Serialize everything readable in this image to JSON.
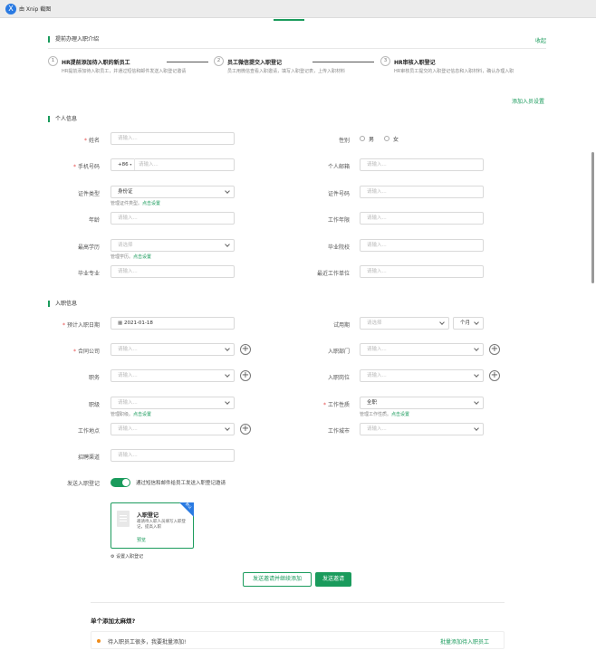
{
  "app": {
    "title": "由 Xnip 截图",
    "logo": "X"
  },
  "intro": {
    "title": "提前办理入职介绍",
    "collapse": "收起",
    "steps": [
      {
        "num": "1",
        "title": "HR提前添加待入职的新员工",
        "desc": "HR提前添加待入职员工，并通过短信和邮件发送入职登记邀请"
      },
      {
        "num": "2",
        "title": "员工微信提交入职登记",
        "desc": "员工用微信查看入职邀请，填写入职登记表，上传入职材料"
      },
      {
        "num": "3",
        "title": "HR审核入职登记",
        "desc": "HR审核员工提交的入职登记信息和入职材料，确认办理入职"
      }
    ]
  },
  "settings_link": "添加入员设置",
  "personal": {
    "title": "个人信息",
    "name": {
      "label": "姓名",
      "placeholder": "请输入..."
    },
    "gender": {
      "label": "性别",
      "male": "男",
      "female": "女"
    },
    "phone": {
      "label": "手机号码",
      "code": "+86",
      "placeholder": "请输入..."
    },
    "email": {
      "label": "个人邮箱",
      "placeholder": "请输入..."
    },
    "id_type": {
      "label": "证件类型",
      "value": "身份证",
      "hint": "管理证件类型。",
      "hint_link": "点击设置"
    },
    "id_no": {
      "label": "证件号码",
      "placeholder": "请输入..."
    },
    "age": {
      "label": "年龄",
      "placeholder": "请输入..."
    },
    "years": {
      "label": "工作年限",
      "placeholder": "请输入..."
    },
    "education": {
      "label": "最高学历",
      "placeholder": "请选择",
      "hint": "管理学历。",
      "hint_link": "点击设置"
    },
    "school": {
      "label": "毕业院校",
      "placeholder": "请输入..."
    },
    "major": {
      "label": "毕业专业",
      "placeholder": "请输入..."
    },
    "last_company": {
      "label": "最近工作单位",
      "placeholder": "请输入..."
    }
  },
  "onboard": {
    "title": "入职信息",
    "date": {
      "label": "预计入职日期",
      "value": "2021-01-18"
    },
    "probation": {
      "label": "试用期",
      "placeholder": "请选择",
      "unit": "个月"
    },
    "company": {
      "label": "合同公司",
      "placeholder": "请输入..."
    },
    "dept": {
      "label": "入职部门",
      "placeholder": "请输入..."
    },
    "position": {
      "label": "职务",
      "placeholder": "请输入..."
    },
    "post": {
      "label": "入职岗位",
      "placeholder": "请输入..."
    },
    "rank": {
      "label": "职级",
      "placeholder": "请输入...",
      "hint": "管理职级。",
      "hint_link": "点击设置"
    },
    "nature": {
      "label": "工作性质",
      "value": "全职",
      "hint": "管理工作性质。",
      "hint_link": "点击设置"
    },
    "location": {
      "label": "工作地点",
      "placeholder": "请输入..."
    },
    "city": {
      "label": "工作城市",
      "placeholder": "请输入..."
    },
    "channel": {
      "label": "招聘渠道",
      "placeholder": "请输入..."
    }
  },
  "send": {
    "label": "发送入职登记",
    "toggle_text": "通过短信和邮件给员工发送入职登记邀请"
  },
  "card": {
    "ribbon": "默认",
    "title": "入职登记",
    "desc": "邀请待入职人员填写入职登记，提高入职",
    "preview": "预览",
    "settings": "设置入职登记"
  },
  "buttons": {
    "send_continue": "发送邀请并继续添加",
    "send": "发送邀请"
  },
  "batch": {
    "title": "单个添加太麻烦?",
    "text": "待入职员工很多，我要批量添加!",
    "link": "批量添加待入职员工"
  }
}
